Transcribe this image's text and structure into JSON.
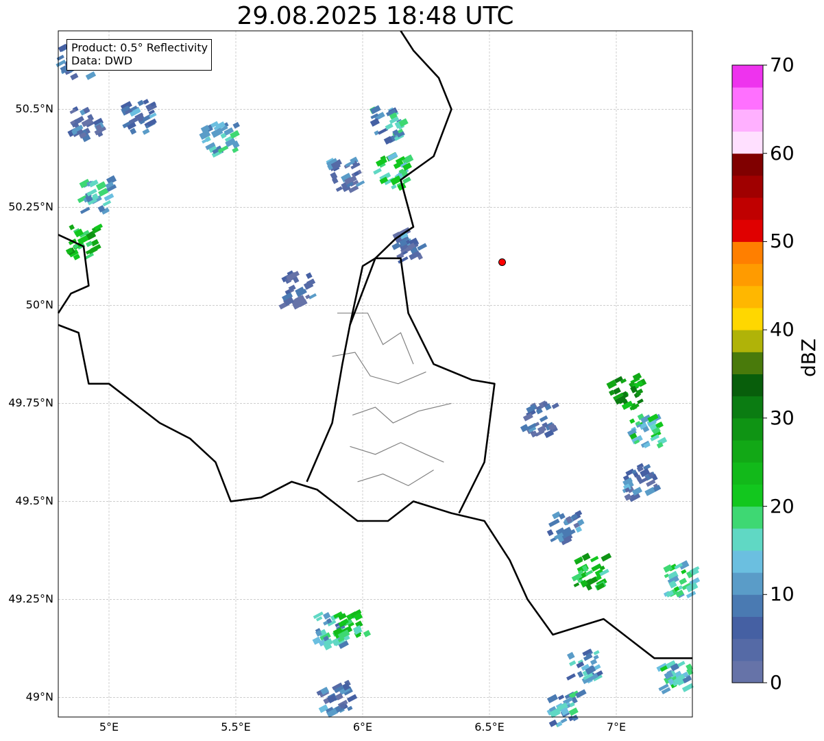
{
  "title": "29.08.2025 18:48 UTC",
  "legend": {
    "product": "Product: 0.5° Reflectivity",
    "source": "Data: DWD"
  },
  "axes": {
    "lat_labels": [
      "50.5°N",
      "50.25°N",
      "50°N",
      "49.75°N",
      "49.5°N",
      "49.25°N",
      "49°N"
    ],
    "lon_labels": [
      "5°E",
      "5.5°E",
      "6°E",
      "6.5°E",
      "7°E"
    ]
  },
  "colorbar": {
    "label": "dBZ",
    "ticks": [
      "0",
      "10",
      "20",
      "30",
      "40",
      "50",
      "60",
      "70"
    ],
    "colors": [
      "#6673a8",
      "#556aa6",
      "#4560a3",
      "#4a7ab2",
      "#5a9cc8",
      "#6bbfe0",
      "#60d8c4",
      "#3ed873",
      "#12c71e",
      "#12b91a",
      "#12a816",
      "#0f9414",
      "#0b7c12",
      "#085e0b",
      "#497a0b",
      "#b0b308",
      "#ffd700",
      "#ffb700",
      "#ff9b00",
      "#ff7f00",
      "#e00000",
      "#c00000",
      "#a00000",
      "#800000",
      "#ffe0ff",
      "#ffb0ff",
      "#ff70ff",
      "#ee33ee"
    ]
  },
  "map_data": {
    "lon_range": [
      4.8,
      7.3
    ],
    "lat_range": [
      48.95,
      50.7
    ],
    "radar_site": {
      "lon": 6.55,
      "lat": 50.11,
      "color": "#ff0000"
    },
    "echoes": [
      {
        "lon": 4.87,
        "lat": 50.62,
        "dbz": 8
      },
      {
        "lon": 4.91,
        "lat": 50.46,
        "dbz": 7
      },
      {
        "lon": 5.12,
        "lat": 50.48,
        "dbz": 10
      },
      {
        "lon": 5.44,
        "lat": 50.42,
        "dbz": 15
      },
      {
        "lon": 4.95,
        "lat": 50.28,
        "dbz": 16
      },
      {
        "lon": 4.9,
        "lat": 50.16,
        "dbz": 24
      },
      {
        "lon": 6.1,
        "lat": 50.46,
        "dbz": 14
      },
      {
        "lon": 6.12,
        "lat": 50.34,
        "dbz": 20
      },
      {
        "lon": 5.93,
        "lat": 50.33,
        "dbz": 8
      },
      {
        "lon": 6.18,
        "lat": 50.15,
        "dbz": 8
      },
      {
        "lon": 5.75,
        "lat": 50.04,
        "dbz": 6
      },
      {
        "lon": 7.04,
        "lat": 49.78,
        "dbz": 28
      },
      {
        "lon": 7.12,
        "lat": 49.68,
        "dbz": 18
      },
      {
        "lon": 7.1,
        "lat": 49.55,
        "dbz": 8
      },
      {
        "lon": 6.9,
        "lat": 49.32,
        "dbz": 24
      },
      {
        "lon": 6.8,
        "lat": 49.44,
        "dbz": 8
      },
      {
        "lon": 7.25,
        "lat": 49.3,
        "dbz": 18
      },
      {
        "lon": 7.24,
        "lat": 49.05,
        "dbz": 16
      },
      {
        "lon": 5.88,
        "lat": 49.17,
        "dbz": 14
      },
      {
        "lon": 5.96,
        "lat": 49.18,
        "dbz": 20
      },
      {
        "lon": 5.9,
        "lat": 49.0,
        "dbz": 8
      },
      {
        "lon": 6.8,
        "lat": 48.97,
        "dbz": 14
      },
      {
        "lon": 6.88,
        "lat": 49.08,
        "dbz": 12
      },
      {
        "lon": 6.7,
        "lat": 49.71,
        "dbz": 6
      }
    ],
    "country_borders": [
      [
        [
          4.8,
          49.95
        ],
        [
          4.88,
          49.93
        ],
        [
          4.92,
          49.8
        ],
        [
          5.0,
          49.8
        ],
        [
          5.1,
          49.75
        ],
        [
          5.2,
          49.7
        ],
        [
          5.32,
          49.66
        ],
        [
          5.42,
          49.6
        ],
        [
          5.48,
          49.5
        ],
        [
          5.6,
          49.51
        ],
        [
          5.72,
          49.55
        ],
        [
          5.82,
          49.53
        ],
        [
          5.88,
          49.5
        ],
        [
          5.98,
          49.45
        ],
        [
          6.1,
          49.45
        ],
        [
          6.2,
          49.5
        ],
        [
          6.35,
          49.47
        ],
        [
          6.48,
          49.45
        ],
        [
          6.58,
          49.35
        ],
        [
          6.65,
          49.25
        ],
        [
          6.75,
          49.16
        ],
        [
          6.85,
          49.18
        ],
        [
          6.95,
          49.2
        ],
        [
          7.05,
          49.15
        ],
        [
          7.15,
          49.1
        ],
        [
          7.3,
          49.1
        ]
      ],
      [
        [
          5.78,
          49.55
        ],
        [
          5.88,
          49.7
        ],
        [
          5.92,
          49.85
        ],
        [
          5.95,
          49.95
        ],
        [
          6.05,
          50.12
        ],
        [
          6.13,
          50.17
        ],
        [
          6.2,
          50.2
        ],
        [
          6.15,
          50.32
        ],
        [
          6.28,
          50.38
        ],
        [
          6.35,
          50.5
        ],
        [
          6.3,
          50.58
        ],
        [
          6.2,
          50.65
        ],
        [
          6.15,
          50.7
        ]
      ],
      [
        [
          5.95,
          49.95
        ],
        [
          6.0,
          50.1
        ],
        [
          6.05,
          50.12
        ],
        [
          6.15,
          50.12
        ],
        [
          6.18,
          49.98
        ],
        [
          6.28,
          49.85
        ],
        [
          6.43,
          49.81
        ],
        [
          6.52,
          49.8
        ],
        [
          6.48,
          49.6
        ],
        [
          6.38,
          49.47
        ]
      ],
      [
        [
          4.8,
          50.18
        ],
        [
          4.9,
          50.15
        ],
        [
          4.92,
          50.05
        ],
        [
          4.85,
          50.03
        ],
        [
          4.8,
          49.98
        ]
      ]
    ],
    "district_borders": [
      [
        [
          5.9,
          49.98
        ],
        [
          6.02,
          49.98
        ],
        [
          6.08,
          49.9
        ],
        [
          6.15,
          49.93
        ],
        [
          6.2,
          49.85
        ]
      ],
      [
        [
          5.88,
          49.87
        ],
        [
          5.97,
          49.88
        ],
        [
          6.03,
          49.82
        ],
        [
          6.14,
          49.8
        ],
        [
          6.25,
          49.83
        ]
      ],
      [
        [
          5.96,
          49.72
        ],
        [
          6.05,
          49.74
        ],
        [
          6.12,
          49.7
        ],
        [
          6.22,
          49.73
        ],
        [
          6.35,
          49.75
        ]
      ],
      [
        [
          5.95,
          49.64
        ],
        [
          6.05,
          49.62
        ],
        [
          6.15,
          49.65
        ],
        [
          6.25,
          49.62
        ],
        [
          6.32,
          49.6
        ]
      ],
      [
        [
          5.98,
          49.55
        ],
        [
          6.08,
          49.57
        ],
        [
          6.18,
          49.54
        ],
        [
          6.28,
          49.58
        ]
      ]
    ]
  }
}
